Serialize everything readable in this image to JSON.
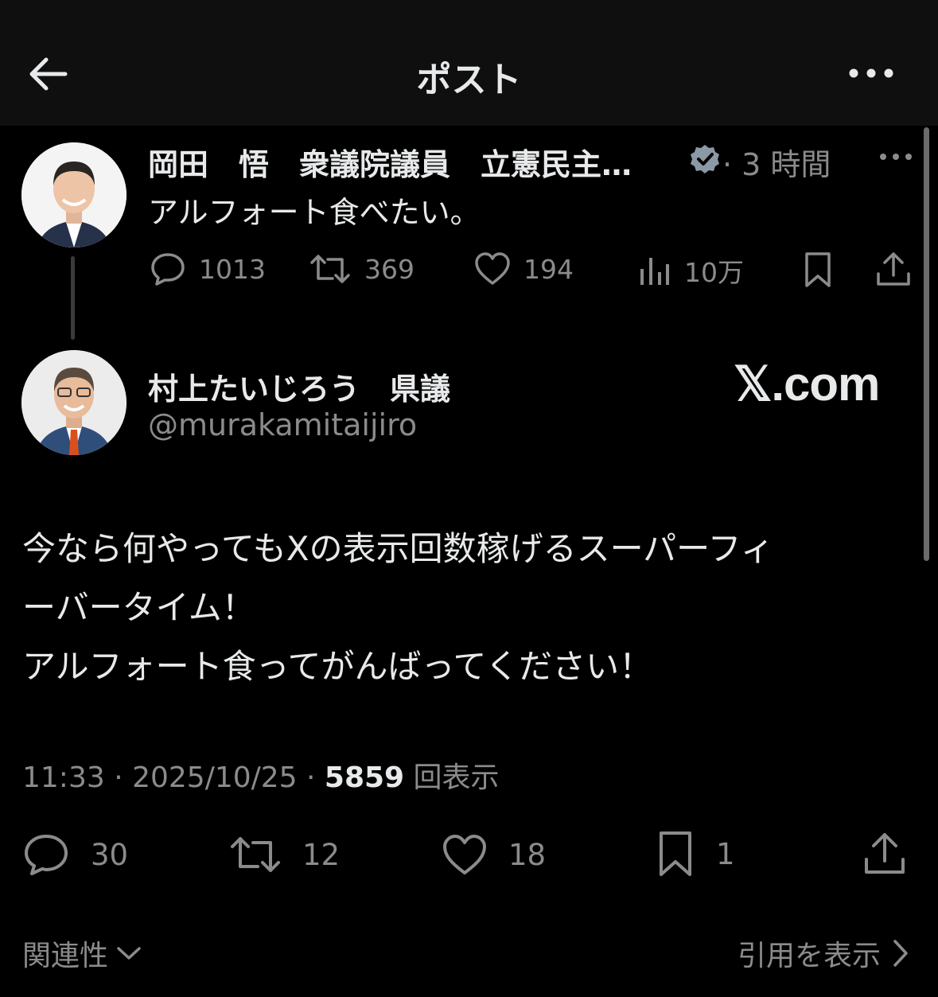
{
  "header": {
    "title": "ポスト",
    "back_icon": "arrow-left-icon",
    "more_icon": "more-horizontal-icon"
  },
  "parent_post": {
    "author_name": "岡田　悟　衆議院議員　立憲民主…",
    "verified_icon": "verified-badge-icon",
    "time": "· 3 時間",
    "text": "アルフォート食べたい。",
    "actions": {
      "replies": "1013",
      "reposts": "369",
      "likes": "194",
      "views": "10万"
    }
  },
  "main_post": {
    "author_name": "村上たいじろう　県議",
    "handle": "@murakamitaijiro",
    "watermark": "𝕏.com",
    "text_lines": [
      "今なら何やってもXの表示回数稼げるスーパーフィ",
      "ーバータイム！",
      "アルフォート食ってがんばってください！"
    ],
    "meta": {
      "time": "11:33 · 2025/10/25 · ",
      "views_count": "5859",
      "views_label": " 回表示"
    },
    "actions": {
      "replies": "30",
      "reposts": "12",
      "likes": "18",
      "bookmarks": "1"
    }
  },
  "footer": {
    "sort_label": "関連性",
    "quotes_label": "引用を表示"
  },
  "colors": {
    "background": "#000000",
    "header_bg": "#0f0f0f",
    "text": "#e7e9ea",
    "muted": "#8b8b8b",
    "verified": "#8b98a5"
  }
}
